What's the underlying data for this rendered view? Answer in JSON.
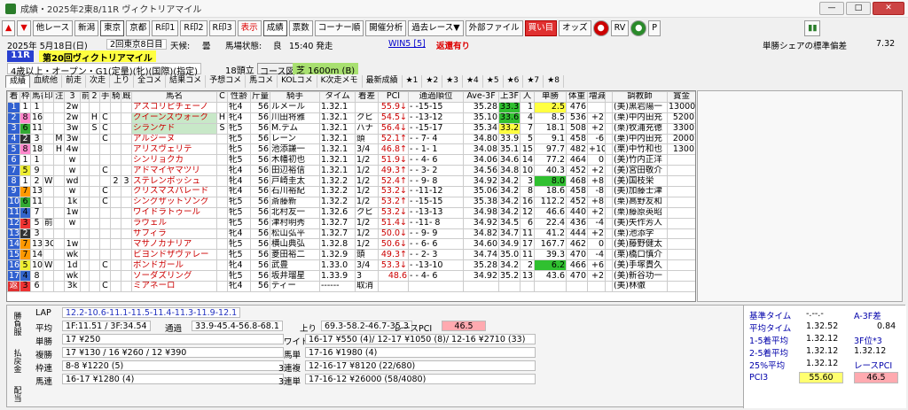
{
  "window": {
    "title": "成績・2025年2東8/11R ヴィクトリアマイル"
  },
  "toolbar": {
    "buttons": [
      "他レース",
      "新潟",
      "東京",
      "京都",
      "R印1",
      "R印2",
      "R印3",
      "表示",
      "成績",
      "票数",
      "コーナー順",
      "開催分析",
      "過去レース▼",
      "外部ファイル",
      "買い目",
      "オッズ",
      "RV",
      "P"
    ]
  },
  "info": {
    "date": "2025年 5月18日(日)",
    "kaisai": "2回東京8日目",
    "weather_label": "天候:",
    "weather": "曇",
    "track_label": "馬場状態:",
    "track": "良",
    "time": "15:40 発走",
    "win5": "WIN5 [5]",
    "refund": "返還有り",
    "std_label": "単勝シェアの標準偏差",
    "std": "7.32"
  },
  "race": {
    "no": "11R",
    "name": "第20回ヴィクトリアマイル",
    "cond": "4歳以上・オープン・G1(定量)(牝)(国際)(指定)",
    "heads": "18頭立",
    "course_label": "コース図",
    "course": "芝 1600m (B)"
  },
  "tabs": [
    "成績",
    "血統他",
    "前走",
    "次走",
    "上り",
    "全コメ",
    "結果コメ",
    "予想コメ",
    "馬コメ",
    "KOLコメ",
    "K次走メモ",
    "最新成績",
    "★1",
    "★2",
    "★3",
    "★4",
    "★5",
    "★6",
    "★7",
    "★8"
  ],
  "grid": {
    "headers": [
      "着",
      "枠",
      "馬番",
      "印",
      "注",
      "3",
      "前",
      "2",
      "手",
      "騎",
      "厩",
      "馬名",
      "C",
      "性齢",
      "斤量",
      "騎手",
      "タイム",
      "着差",
      "PCI",
      "通過順位",
      "Ave-3F",
      "上3F",
      "人",
      "単勝",
      "体重",
      "増減",
      "",
      "調教師",
      "賞金",
      "馬記号"
    ],
    "rows": [
      [
        "1",
        "1",
        "1",
        "",
        "",
        "2w",
        "",
        "",
        "",
        "",
        "",
        "アスコリピチェーノ",
        "",
        "牝4",
        "56",
        "ルメール",
        "1.32.1",
        "",
        "55.9↓",
        "- -15-15",
        "35.28",
        "33.3",
        "1",
        "2.5",
        "476",
        "",
        "",
        "(美)黒岩陽一",
        "13000",
        ""
      ],
      [
        "2",
        "8",
        "16",
        "",
        "",
        "2w",
        "",
        "H",
        "C",
        "",
        "",
        "クイーンズウォーク",
        "H",
        "牝4",
        "56",
        "川田将雅",
        "1.32.1",
        "クビ",
        "54.5↓",
        "- -13-12",
        "35.10",
        "33.6",
        "4",
        "8.5",
        "536",
        "+2",
        "",
        "(栗)中内田充",
        "5200",
        ""
      ],
      [
        "3",
        "6",
        "11",
        "",
        "",
        "3w",
        "",
        "S",
        "C",
        "",
        "",
        "シランケド",
        "S",
        "牝5",
        "56",
        "M.デム",
        "1.32.1",
        "ハナ",
        "56.4↓",
        "- -15-17",
        "35.34",
        "33.2",
        "7",
        "18.1",
        "508",
        "+2",
        "",
        "(栗)牧浦充徳",
        "3300",
        ""
      ],
      [
        "4",
        "2",
        "3",
        "",
        "M",
        "3w",
        "",
        "",
        "C",
        "",
        "",
        "アルジーヌ",
        "",
        "牝5",
        "56",
        "レーン",
        "1.32.1",
        "頭",
        "52.1↑",
        "- - 7- 4",
        "34.80",
        "33.9",
        "5",
        "9.1",
        "458",
        "-6",
        "",
        "(栗)中内田充",
        "2000",
        ""
      ],
      [
        "5",
        "8",
        "18",
        "",
        "H",
        "4w",
        "",
        "",
        "",
        "",
        "",
        "アリスヴェリテ",
        "",
        "牝5",
        "56",
        "池添謙一",
        "1.32.1",
        "3/4",
        "46.8↑",
        "- - 1- 1",
        "34.08",
        "35.1",
        "15",
        "97.7",
        "482",
        "+10",
        "",
        "(栗)中竹和也",
        "1300",
        ""
      ],
      [
        "6",
        "1",
        "1",
        "",
        "",
        "w",
        "",
        "",
        "",
        "",
        "",
        "シンリョクカ",
        "",
        "牝5",
        "56",
        "木幡初也",
        "1.32.1",
        "1/2",
        "51.9↓",
        "- - 4- 6",
        "34.06",
        "34.6",
        "14",
        "77.2",
        "464",
        "0",
        "",
        "(美)竹内正洋",
        "",
        ""
      ],
      [
        "7",
        "5",
        "9",
        "",
        "",
        "w",
        "",
        "",
        "C",
        "",
        "",
        "アドマイヤマツリ",
        "",
        "牝4",
        "56",
        "田辺裕信",
        "1.32.1",
        "1/2",
        "49.3↑",
        "- - 3- 2",
        "34.56",
        "34.8",
        "10",
        "40.3",
        "452",
        "+2",
        "",
        "(美)宮田敬介",
        "",
        ""
      ],
      [
        "8",
        "1",
        "2",
        "W",
        "",
        "wd",
        "",
        "",
        "",
        "2",
        "3",
        "ステレンボッシュ",
        "",
        "牝4",
        "56",
        "戸崎圭太",
        "1.32.2",
        "1/2",
        "52.4↑",
        "- - 9- 8",
        "34.92",
        "34.2",
        "3",
        "8.0",
        "468",
        "+8",
        "",
        "(美)国枝栄",
        "",
        ""
      ],
      [
        "9",
        "7",
        "13",
        "",
        "",
        "w",
        "",
        "",
        "C",
        "",
        "",
        "クリスマスパレード",
        "",
        "牝4",
        "56",
        "石川裕紀",
        "1.32.2",
        "1/2",
        "53.2↓",
        "- -11-12",
        "35.06",
        "34.2",
        "8",
        "18.6",
        "458",
        "-8",
        "",
        "(美)加藤士津",
        "",
        ""
      ],
      [
        "10",
        "6",
        "11",
        "",
        "",
        "1k",
        "",
        "",
        "C",
        "",
        "",
        "シングザットソング",
        "",
        "牝5",
        "56",
        "斎藤新",
        "1.32.2",
        "1/2",
        "53.2↑",
        "- -15-15",
        "35.38",
        "34.2",
        "16",
        "112.2",
        "452",
        "+8",
        "",
        "(栗)高野友和",
        "",
        ""
      ],
      [
        "11",
        "4",
        "7",
        "",
        "",
        "1w",
        "",
        "",
        "",
        "",
        "",
        "ワイドラトゥール",
        "",
        "牝5",
        "56",
        "北村友一",
        "1.32.6",
        "クビ",
        "53.2↓",
        "- -13-13",
        "34.98",
        "34.2",
        "12",
        "46.6",
        "440",
        "+2",
        "",
        "(栗)藤原英昭",
        "",
        ""
      ],
      [
        "12",
        "3",
        "5",
        "前",
        "",
        "w",
        "",
        "",
        "",
        "",
        "",
        "ラヴェル",
        "",
        "牝5",
        "56",
        "津村明秀",
        "1.32.7",
        "1/2",
        "51.4↓",
        "- -11- 8",
        "34.92",
        "34.5",
        "6",
        "22.4",
        "436",
        "-4",
        "",
        "(美)矢作芳人",
        "",
        ""
      ],
      [
        "13",
        "2",
        "3",
        "",
        "",
        "",
        "",
        "",
        "",
        "",
        "",
        "サフィラ",
        "",
        "牝4",
        "56",
        "松山弘平",
        "1.32.7",
        "1/2",
        "50.0↓",
        "- - 9- 9",
        "34.82",
        "34.7",
        "11",
        "41.2",
        "444",
        "+2",
        "",
        "(栗)池添学",
        "",
        ""
      ],
      [
        "14",
        "7",
        "13",
        "3C",
        "",
        "1w",
        "",
        "",
        "",
        "",
        "",
        "マサノカナリア",
        "",
        "牝5",
        "56",
        "横山典弘",
        "1.32.8",
        "1/2",
        "50.6↓",
        "- - 6- 6",
        "34.60",
        "34.9",
        "17",
        "167.7",
        "462",
        "0",
        "",
        "(美)藤野健太",
        "",
        ""
      ],
      [
        "15",
        "7",
        "14",
        "",
        "",
        "wk",
        "",
        "",
        "",
        "",
        "",
        "ビヨンドザヴァレー",
        "",
        "牝5",
        "56",
        "菱田裕二",
        "1.32.9",
        "頭",
        "49.3↑",
        "- - 2- 3",
        "34.74",
        "35.0",
        "11",
        "39.3",
        "470",
        "-4",
        "",
        "(栗)橋口慎介",
        "",
        ""
      ],
      [
        "16",
        "5",
        "10",
        "W",
        "",
        "1d",
        "",
        "",
        "C",
        "",
        "",
        "ボンドガール",
        "",
        "牝4",
        "56",
        "武豊",
        "1.33.0",
        "3/4",
        "53.3↓",
        "- -13-10",
        "35.28",
        "34.2",
        "2",
        "6.2",
        "466",
        "+6",
        "",
        "(美)手塚貴久",
        "",
        ""
      ],
      [
        "17",
        "4",
        "8",
        "",
        "",
        "wk",
        "",
        "",
        "",
        "",
        "",
        "ソーダズリング",
        "",
        "牝5",
        "56",
        "坂井瑠星",
        "1.33.9",
        "3",
        "48.6",
        "- - 4- 6",
        "34.92",
        "35.2",
        "13",
        "43.6",
        "470",
        "+2",
        "",
        "(美)新谷功一",
        "",
        ""
      ],
      [
        "返",
        "3",
        "6",
        "",
        "",
        "3k",
        "",
        "",
        "C",
        "",
        "",
        "ミアネーロ",
        "",
        "牝4",
        "56",
        "ディー",
        "------",
        "取消",
        "",
        "",
        "",
        "",
        "",
        "",
        "",
        "",
        "",
        "(美)林徹",
        "",
        ""
      ]
    ]
  },
  "bottom": {
    "lap_label": "LAP",
    "lap": "12.2-10.6-11.1-11.5-11.4-11.3-11.9-12.1",
    "heikin_label": "平均",
    "heikin": "1F:11.51 / 3F:34.54",
    "tsuka_label": "通過",
    "tsuka": "33.9-45.4-56.8-68.1",
    "agari_label": "上り",
    "agari": "69.3-58.2-46.7-35.3",
    "racepci_label": "レースPCI",
    "racepci": "46.5",
    "tan_label": "単勝",
    "tan": "17 ¥250",
    "fuku_label": "複勝",
    "fuku": "17 ¥130 / 16 ¥260 / 12 ¥390",
    "wakuren_label": "枠連",
    "wakuren": "8-8 ¥1220 (5)",
    "umaren_label": "馬連",
    "umaren": "16-17 ¥1280 (4)",
    "wide_label": "ワイド",
    "wide": "16-17 ¥550 (4)/ 12-17 ¥1050 (8)/ 12-16 ¥2710 (33)",
    "umatan_label": "馬単",
    "umatan": "17-16 ¥1980 (4)",
    "sanfuku_label": "3連複",
    "sanfuku": "12-16-17 ¥8120 (22/680)",
    "santan_label": "3連単",
    "santan": "17-16-12 ¥26000 (58/4080)",
    "side": [
      "勝負服",
      "払戻金",
      "配当"
    ]
  },
  "stats": {
    "kijun_label": "基準タイム",
    "kijun": "-.--.-",
    "a3f_label": "A-3F差",
    "a3f": "0.84",
    "heikintime_label": "平均タイム",
    "heikintime": "1.32.52",
    "b1_label": "1-5着平均",
    "b1": "1.32.12",
    "b1v": "3F位*3",
    "b2_label": "2-5着平均",
    "b2": "1.32.12",
    "b2v": "1.32.12",
    "b3_label": "25%平均",
    "b3": "1.32.12",
    "b3v_label": "レースPCI",
    "pci3_label": "PCI3",
    "pci3": "55.60",
    "rpci": "46.5"
  }
}
